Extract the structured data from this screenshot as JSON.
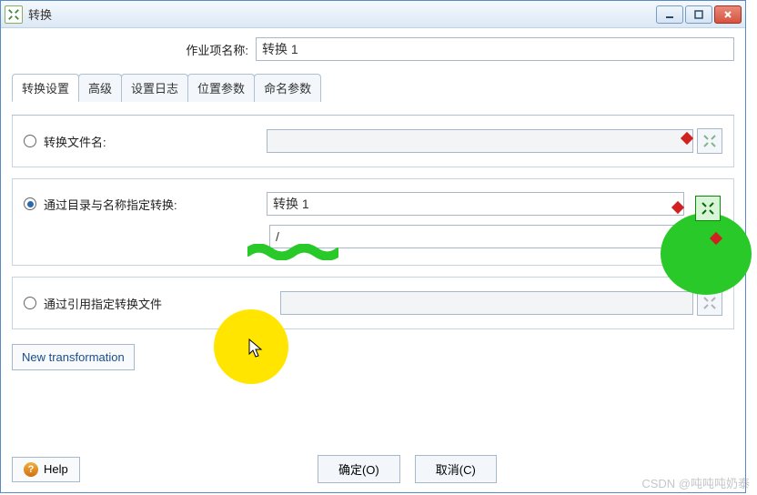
{
  "window": {
    "title": "转换"
  },
  "header": {
    "label": "作业项名称:",
    "value": "转换 1"
  },
  "tabs": [
    "转换设置",
    "高级",
    "设置日志",
    "位置参数",
    "命名参数"
  ],
  "panel1": {
    "radio_label": "转换文件名:"
  },
  "panel2": {
    "radio_label": "通过目录与名称指定转换:",
    "name_value": "转换 1",
    "path_value": "/"
  },
  "panel3": {
    "radio_label": "通过引用指定转换文件"
  },
  "new_transformation": "New transformation",
  "footer": {
    "help": "Help",
    "ok": "确定(O)",
    "cancel": "取消(C)"
  },
  "watermark": "CSDN @吨吨吨奶泰"
}
